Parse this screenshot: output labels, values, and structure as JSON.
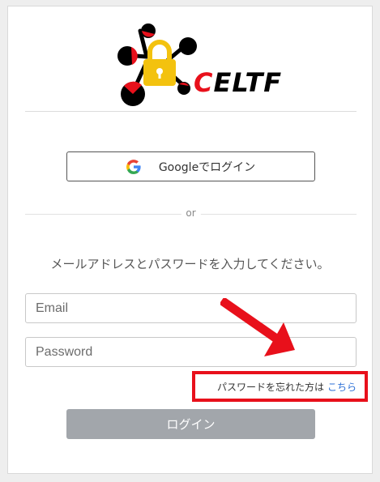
{
  "logo": {
    "brand_c": "C",
    "brand_rest": "ELTF",
    "icons": [
      "lock-icon",
      "network-nodes"
    ],
    "colors": {
      "lock": "#f3c20f",
      "node_red": "#e8101b",
      "node_black": "#000000"
    }
  },
  "google_login": {
    "label": "Googleでログイン",
    "icon": "google-g-icon"
  },
  "divider": {
    "or": "or"
  },
  "instruction": "メールアドレスとパスワードを入力してください。",
  "email": {
    "placeholder": "Email",
    "value": ""
  },
  "password": {
    "placeholder": "Password",
    "value": ""
  },
  "forgot": {
    "text": "パスワードを忘れた方は",
    "link": "こちら"
  },
  "login_button": {
    "label": "ログイン"
  },
  "annotations": {
    "arrow_color": "#e8101b",
    "highlight_box_color": "#e8101b"
  }
}
